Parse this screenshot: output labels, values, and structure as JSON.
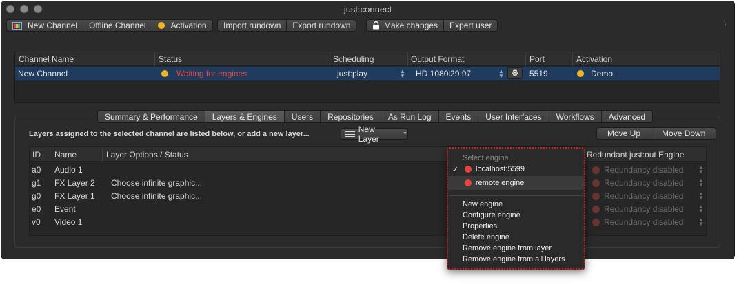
{
  "window": {
    "title": "just:connect",
    "corner_mark": "\\"
  },
  "toolbar": {
    "group1": [
      "New Channel",
      "Offline Channel",
      "Activation"
    ],
    "group2": [
      "Import rundown",
      "Export rundown"
    ],
    "group3": [
      "Make changes",
      "Expert user"
    ]
  },
  "channels": {
    "headers": [
      "Channel Name",
      "Status",
      "Scheduling",
      "Output Format",
      "Port",
      "Activation"
    ],
    "row": {
      "name": "New Channel",
      "status": "Waiting for engines",
      "scheduling": "just:play",
      "output_format": "HD 1080i29.97",
      "port": "5519",
      "activation": "Demo"
    }
  },
  "tabs": [
    "Summary & Performance",
    "Layers & Engines",
    "Users",
    "Repositories",
    "As Run Log",
    "Events",
    "User Interfaces",
    "Workflows",
    "Advanced"
  ],
  "active_tab": "Layers & Engines",
  "layers_panel": {
    "hint": "Layers assigned to the selected channel are listed below, or add a new layer...",
    "new_layer": "New Layer",
    "move_up": "Move Up",
    "move_down": "Move Down",
    "headers": {
      "id": "ID",
      "name": "Name",
      "options": "Layer Options / Status",
      "redundant": "Redundant just:out Engine"
    },
    "rows": [
      {
        "id": "a0",
        "name": "Audio 1",
        "options": "",
        "redundancy": "Redundancy disabled"
      },
      {
        "id": "g1",
        "name": "FX Layer 2",
        "options": "Choose infinite graphic...",
        "redundancy": "Redundancy disabled"
      },
      {
        "id": "g0",
        "name": "FX Layer 1",
        "options": "Choose infinite graphic...",
        "redundancy": "Redundancy disabled"
      },
      {
        "id": "e0",
        "name": "Event",
        "options": "",
        "redundancy": "Redundancy disabled"
      },
      {
        "id": "v0",
        "name": "Video 1",
        "options": "",
        "redundancy": "Redundancy disabled"
      }
    ]
  },
  "engine_menu": {
    "placeholder": "Select engine...",
    "engines": [
      {
        "label": "localhost:5599",
        "checked": true
      },
      {
        "label": "remote engine",
        "checked": false
      }
    ],
    "check_mark": "✓",
    "actions": [
      "New engine",
      "Configure engine",
      "Properties",
      "Delete engine",
      "Remove engine from layer",
      "Remove engine from all layers"
    ]
  },
  "colors": {
    "selection": "#1f3b5e",
    "status_warning": "#e8453c",
    "amber": "#f0b323"
  }
}
